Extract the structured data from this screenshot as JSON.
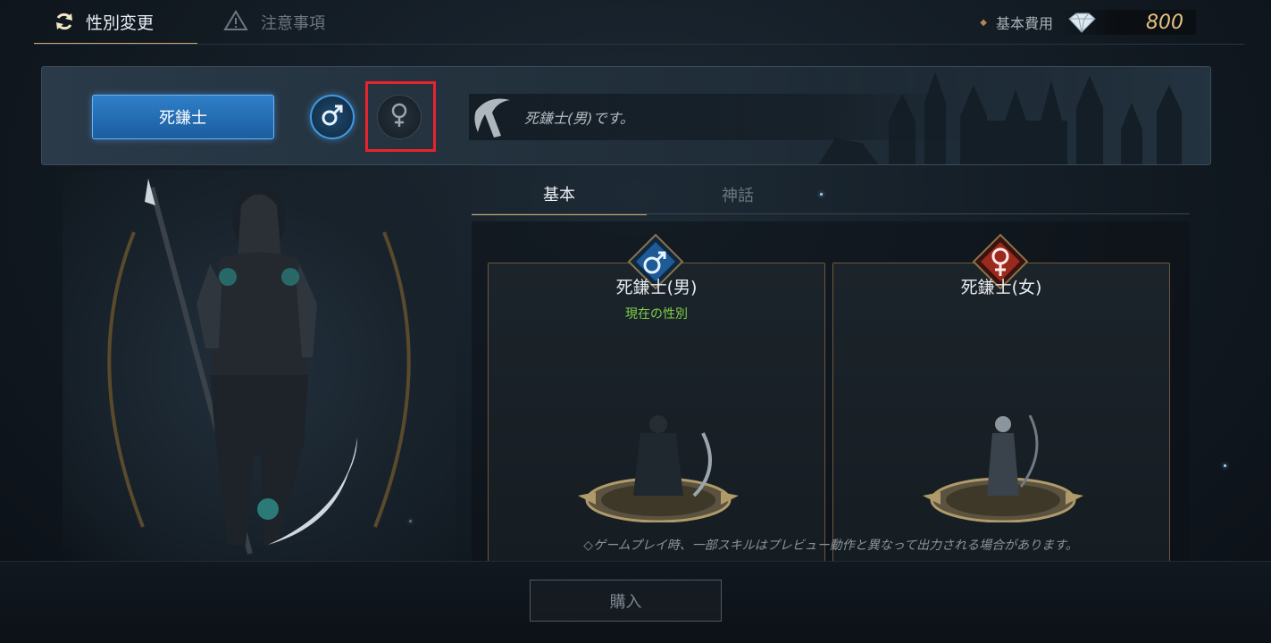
{
  "header": {
    "active_tab": "性別変更",
    "notes_tab": "注意事項",
    "cost_label": "基本費用",
    "cost_value": "800"
  },
  "class_panel": {
    "class_button": "死鎌士",
    "male_symbol": "♂",
    "female_symbol": "♀",
    "description": "死鎌士(男)です。"
  },
  "sub_tabs": {
    "basic": "基本",
    "myth": "神話"
  },
  "cards": {
    "male": {
      "name": "死鎌士(男)",
      "current": "現在の性別",
      "symbol": "♂"
    },
    "female": {
      "name": "死鎌士(女)",
      "symbol": "♀"
    }
  },
  "note": "◇ゲームプレイ時、一部スキルはプレビュー動作と異なって出力される場合があります。",
  "buy_button": "購入",
  "colors": {
    "accent_gold": "#c9a96a",
    "male_blue": "#3f9be6",
    "female_red": "#c0392b",
    "current_green": "#7ed14a",
    "highlight_red": "#e8232b"
  }
}
